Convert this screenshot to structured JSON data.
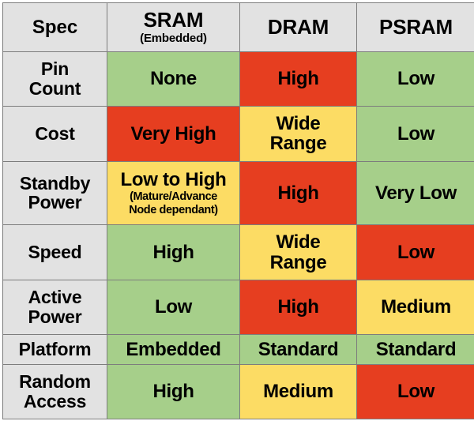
{
  "table": {
    "columns": [
      {
        "key": "spec",
        "label": "Spec",
        "sub": ""
      },
      {
        "key": "sram",
        "label": "SRAM",
        "sub": "(Embedded)"
      },
      {
        "key": "dram",
        "label": "DRAM",
        "sub": ""
      },
      {
        "key": "psram",
        "label": "PSRAM",
        "sub": ""
      }
    ],
    "rows": [
      {
        "label": "Pin\nCount",
        "cells": [
          {
            "value": "None",
            "sub": "",
            "rating": "good"
          },
          {
            "value": "High",
            "sub": "",
            "rating": "bad"
          },
          {
            "value": "Low",
            "sub": "",
            "rating": "good"
          }
        ]
      },
      {
        "label": "Cost",
        "cells": [
          {
            "value": "Very High",
            "sub": "",
            "rating": "bad"
          },
          {
            "value": "Wide\nRange",
            "sub": "",
            "rating": "mid"
          },
          {
            "value": "Low",
            "sub": "",
            "rating": "good"
          }
        ]
      },
      {
        "label": "Standby\nPower",
        "cells": [
          {
            "value": "Low to High",
            "sub": "(Mature/Advance\nNode dependant)",
            "rating": "mid"
          },
          {
            "value": "High",
            "sub": "",
            "rating": "bad"
          },
          {
            "value": "Very Low",
            "sub": "",
            "rating": "good"
          }
        ]
      },
      {
        "label": "Speed",
        "cells": [
          {
            "value": "High",
            "sub": "",
            "rating": "good"
          },
          {
            "value": "Wide\nRange",
            "sub": "",
            "rating": "mid"
          },
          {
            "value": "Low",
            "sub": "",
            "rating": "bad"
          }
        ]
      },
      {
        "label": "Active\nPower",
        "cells": [
          {
            "value": "Low",
            "sub": "",
            "rating": "good"
          },
          {
            "value": "High",
            "sub": "",
            "rating": "bad"
          },
          {
            "value": "Medium",
            "sub": "",
            "rating": "mid"
          }
        ]
      },
      {
        "label": "Platform",
        "cells": [
          {
            "value": "Embedded",
            "sub": "",
            "rating": "good"
          },
          {
            "value": "Standard",
            "sub": "",
            "rating": "good"
          },
          {
            "value": "Standard",
            "sub": "",
            "rating": "good"
          }
        ]
      },
      {
        "label": "Random\nAccess",
        "cells": [
          {
            "value": "High",
            "sub": "",
            "rating": "good"
          },
          {
            "value": "Medium",
            "sub": "",
            "rating": "mid"
          },
          {
            "value": "Low",
            "sub": "",
            "rating": "bad"
          }
        ]
      }
    ]
  },
  "colors": {
    "good": "#a6cf8a",
    "mid": "#fcdc64",
    "bad": "#e63e20",
    "label_bg": "#e2e2e2",
    "grid": "#7d7d7d",
    "text": "#000000"
  }
}
